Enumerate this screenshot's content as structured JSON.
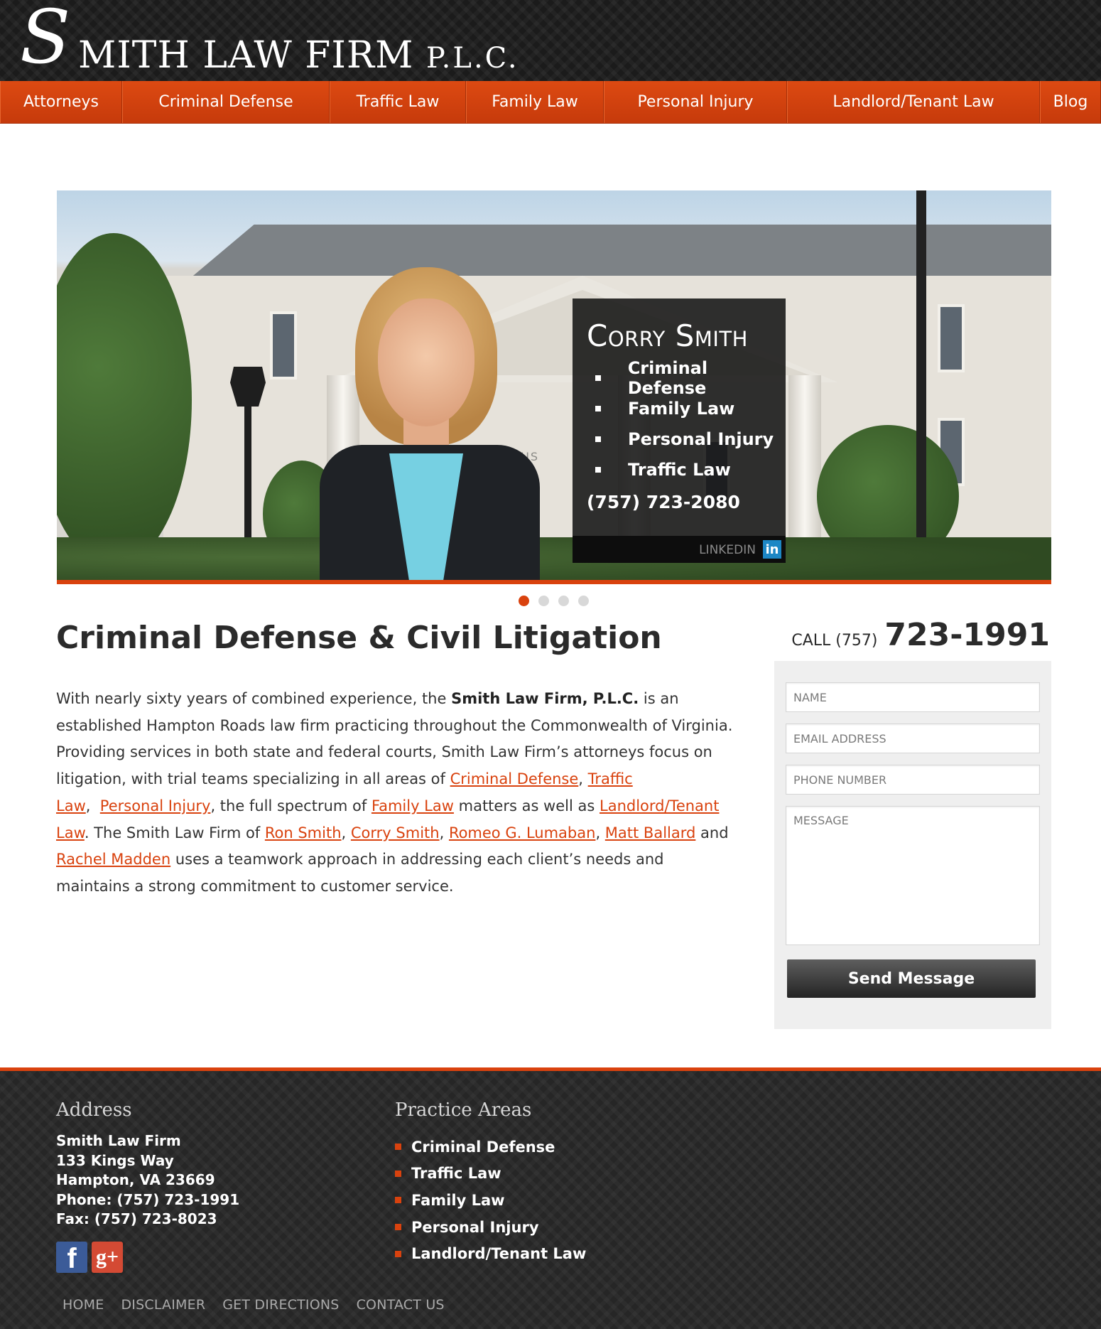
{
  "logo": {
    "initial": "S",
    "rest": "MITH LAW FIRM",
    "suffix": "P.L.C."
  },
  "nav": {
    "items": [
      {
        "label": "Attorneys"
      },
      {
        "label": "Criminal Defense"
      },
      {
        "label": "Traffic Law"
      },
      {
        "label": "Family Law"
      },
      {
        "label": "Personal Injury"
      },
      {
        "label": "Landlord/Tenant Law"
      },
      {
        "label": "Blog"
      }
    ]
  },
  "hero": {
    "building_sign": "URT HOUS",
    "name": "Corry Smith",
    "practice_list": [
      "Criminal Defense",
      "Family Law",
      "Personal Injury",
      "Traffic Law"
    ],
    "phone": "(757) 723-2080",
    "linkedin_label": "LINKEDIN",
    "linkedin_icon": "in",
    "slide_count": 4,
    "active_slide": 1
  },
  "main": {
    "title": "Criminal Defense & Civil Litigation",
    "copy": {
      "p1": "With nearly sixty years of combined experience, the ",
      "firm": "Smith Law Firm, P.L.C.",
      "p2": "  is an established Hampton Roads law firm practicing throughout the Commonwealth of Virginia. Providing services in both state and federal courts, Smith Law Firm’s attorneys focus on litigation, with trial teams specializing in all areas of ",
      "link_criminal": "Criminal Defense",
      "sep1": ", ",
      "link_traffic": "Traffic Law",
      "sep2": ",  ",
      "link_injury": "Personal Injury",
      "p3": ", the full spectrum of ",
      "link_family": "Family Law",
      "p4": " matters as well as ",
      "link_landlord": "Landlord/Tenant Law",
      "p5": ". The Smith Law Firm of ",
      "link_ron": "Ron Smith",
      "sep3": ", ",
      "link_corry": "Corry Smith",
      "sep4": ", ",
      "link_romeo": "Romeo G. Lumaban",
      "sep5": ", ",
      "link_matt": "Matt Ballard",
      "p6": " and ",
      "link_rachel": "Rachel Madden",
      "p7": " uses a teamwork approach in addressing each client’s needs and maintains a strong commitment to customer service."
    }
  },
  "call": {
    "label": "CALL (757)",
    "number": "723-1991"
  },
  "form": {
    "name_placeholder": "NAME",
    "email_placeholder": "EMAIL ADDRESS",
    "phone_placeholder": "PHONE NUMBER",
    "message_placeholder": "MESSAGE",
    "send_label": "Send Message"
  },
  "footer": {
    "address_heading": "Address",
    "address_lines": [
      "Smith Law Firm",
      "133 Kings Way",
      "Hampton, VA 23669",
      "Phone: (757) 723-1991",
      "Fax: (757) 723-8023"
    ],
    "social": {
      "facebook_glyph": "f",
      "googleplus_glyph": "g+"
    },
    "areas_heading": "Practice Areas",
    "areas": [
      "Criminal Defense",
      "Traffic Law",
      "Family Law",
      "Personal Injury",
      "Landlord/Tenant Law"
    ],
    "links": [
      "HOME",
      "DISCLAIMER",
      "GET DIRECTIONS",
      "CONTACT US"
    ]
  },
  "colors": {
    "accent": "#d9420e",
    "dark": "#1b1b1b",
    "panel": "#efefef"
  }
}
